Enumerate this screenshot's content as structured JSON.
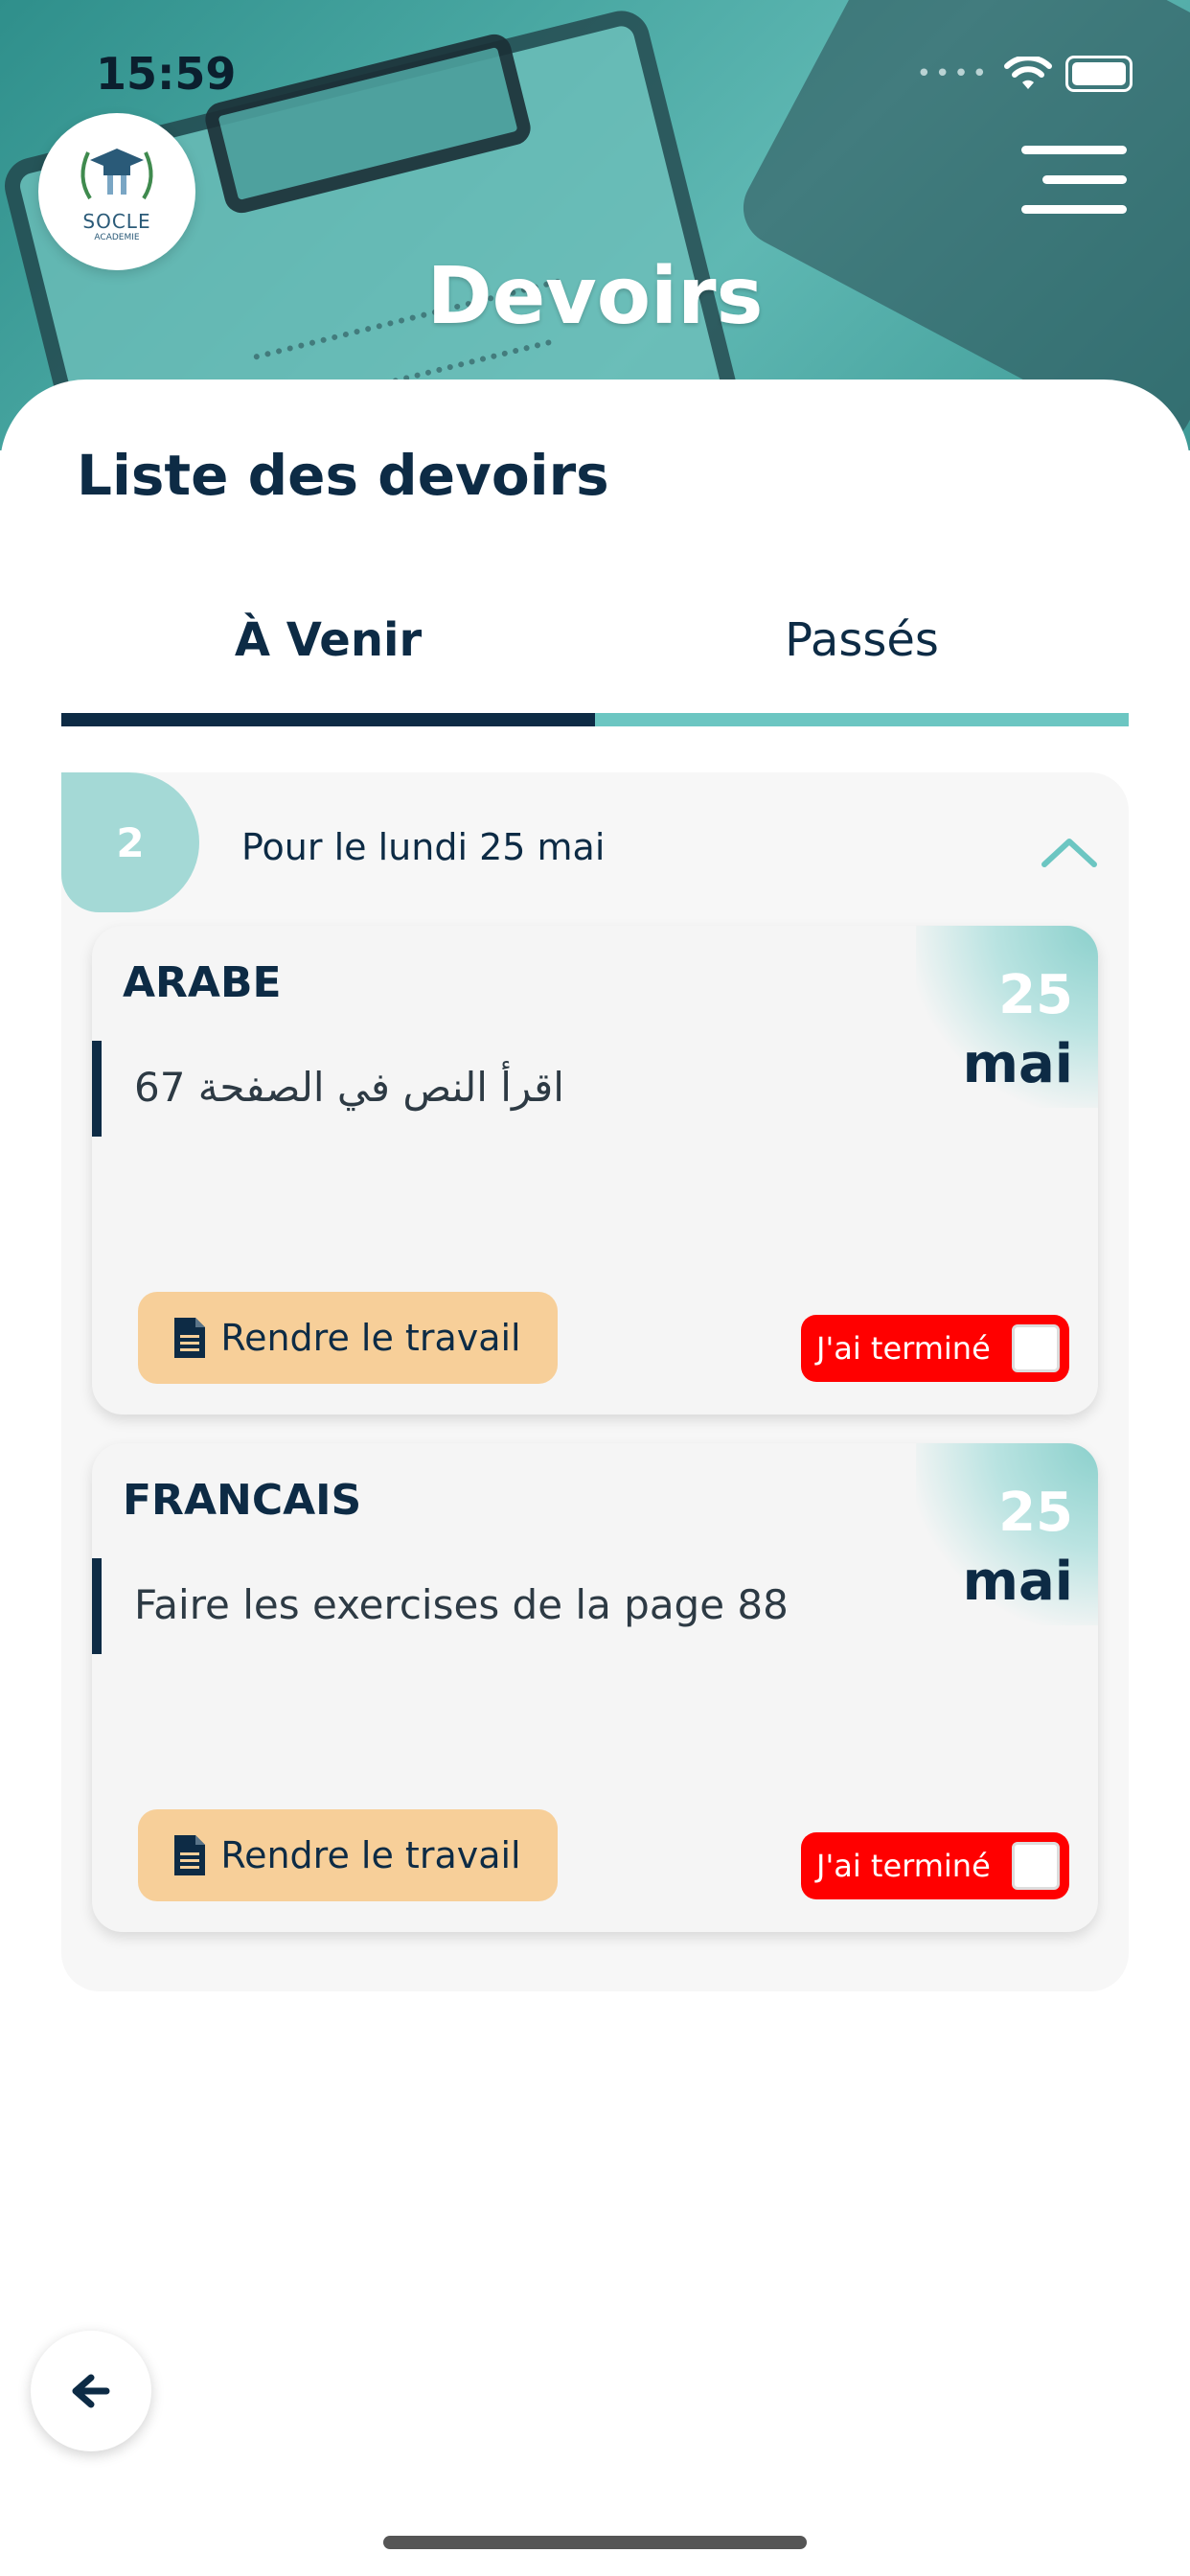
{
  "status_bar": {
    "time": "15:59"
  },
  "header": {
    "logo_text": "SOCLE",
    "logo_subtext": "ACADEMIE",
    "title": "Devoirs"
  },
  "list": {
    "title": "Liste des devoirs"
  },
  "tabs": [
    {
      "label": "À Venir",
      "active": true
    },
    {
      "label": "Passés",
      "active": false
    }
  ],
  "group": {
    "count": "2",
    "date_label": "Pour le lundi 25 mai",
    "expanded": true
  },
  "cards": [
    {
      "subject": "ARABE",
      "day": "25",
      "month": "mai",
      "description": "اقرأ النص في الصفحة 67",
      "submit_label": "Rendre le travail",
      "done_label": "J'ai terminé",
      "done_checked": false
    },
    {
      "subject": "FRANCAIS",
      "day": "25",
      "month": "mai",
      "description": "Faire les exercises de la page 88",
      "submit_label": "Rendre le travail",
      "done_label": "J'ai terminé",
      "done_checked": false
    }
  ],
  "colors": {
    "navy": "#0d2b45",
    "teal": "#6cc6c2",
    "submit_bg": "#f7cf99",
    "done_bg": "#ff0000"
  },
  "icons": {
    "menu": "hamburger-menu-icon",
    "back": "arrow-left-icon",
    "chevron": "chevron-up-icon",
    "document": "document-icon"
  }
}
